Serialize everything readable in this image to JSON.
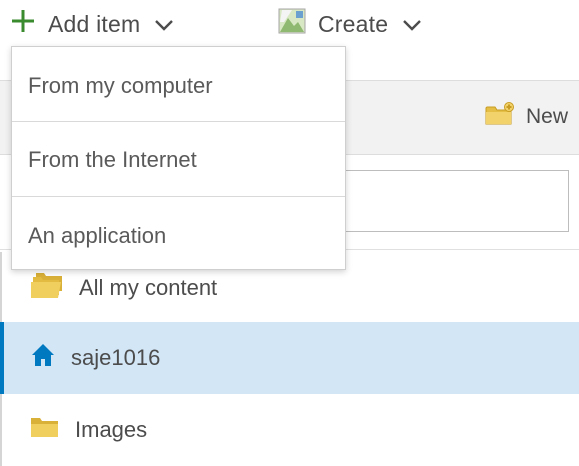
{
  "toolbar": {
    "add_item_label": "Add item",
    "create_label": "Create"
  },
  "dropdown": {
    "items": [
      {
        "label": "From my computer"
      },
      {
        "label": "From the Internet"
      },
      {
        "label": "An application"
      }
    ]
  },
  "content_header": {
    "new_folder_label": "New"
  },
  "filter": {
    "value": "",
    "placeholder": ""
  },
  "folders": [
    {
      "label": "All my content",
      "icon": "folder-stack-icon",
      "selected": false
    },
    {
      "label": "saje1016",
      "icon": "home-icon",
      "selected": true
    },
    {
      "label": "Images",
      "icon": "folder-icon",
      "selected": false
    }
  ],
  "colors": {
    "accent": "#0079c1",
    "selected_bg": "#d2e6f6",
    "plus_green": "#3a8a2e",
    "folder_yellow": "#e7c24a"
  }
}
